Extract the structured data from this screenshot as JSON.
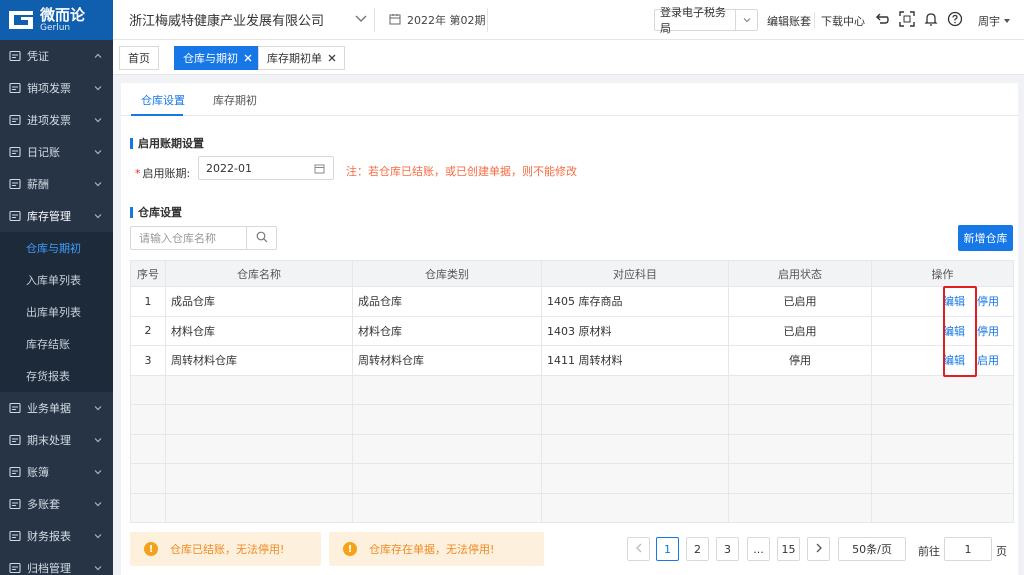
{
  "brand": {
    "name_cn": "微而论",
    "name_en": "Gerlun",
    "color": "#0f5fae"
  },
  "header": {
    "company": "浙江梅威特健康产业发展有限公司",
    "period": "2022年 第02期",
    "tax_bureau": "登录电子税务局",
    "edit_books": "编辑账套",
    "download_center": "下载中心",
    "user": "周宇"
  },
  "sidebar": {
    "items": [
      {
        "label": "凭证",
        "icon": "voucher-icon"
      },
      {
        "label": "销项发票",
        "icon": "invoice-out-icon"
      },
      {
        "label": "进项发票",
        "icon": "invoice-in-icon"
      },
      {
        "label": "日记账",
        "icon": "journal-icon"
      },
      {
        "label": "薪酬",
        "icon": "salary-icon"
      },
      {
        "label": "库存管理",
        "icon": "inventory-icon"
      }
    ],
    "subitems": [
      "仓库与期初",
      "入库单列表",
      "出库单列表",
      "库存结账",
      "存货报表"
    ],
    "items_after": [
      {
        "label": "业务单据",
        "icon": "business-doc-icon"
      },
      {
        "label": "期末处理",
        "icon": "period-end-icon"
      },
      {
        "label": "账簿",
        "icon": "ledger-icon"
      },
      {
        "label": "多账套",
        "icon": "multi-book-icon"
      },
      {
        "label": "财务报表",
        "icon": "report-icon"
      },
      {
        "label": "归档管理",
        "icon": "archive-icon"
      }
    ]
  },
  "tabs": {
    "home": "首页",
    "warehouse": "仓库与期初",
    "inventory_init": "库存期初单"
  },
  "subtabs": {
    "settings": "仓库设置",
    "init": "库存期初"
  },
  "period_section": {
    "title": "启用账期设置",
    "required_mark": "*",
    "label": "启用账期:",
    "value": "2022-01",
    "note": "注：若仓库已结账，或已创建单据，则不能修改"
  },
  "warehouse_section": {
    "title": "仓库设置",
    "search_placeholder": "请输入仓库名称",
    "add_button": "新增仓库"
  },
  "table": {
    "headers": [
      "序号",
      "仓库名称",
      "仓库类别",
      "对应科目",
      "启用状态",
      "操作"
    ],
    "rows": [
      {
        "no": "1",
        "name": "成品仓库",
        "type": "成品仓库",
        "account": "1405 库存商品",
        "status": "已启用",
        "edit": "编辑",
        "toggle": "停用"
      },
      {
        "no": "2",
        "name": "材料仓库",
        "type": "材料仓库",
        "account": "1403 原材料",
        "status": "已启用",
        "edit": "编辑",
        "toggle": "停用"
      },
      {
        "no": "3",
        "name": "周转材料仓库",
        "type": "周转材料仓库",
        "account": "1411 周转材料",
        "status": "停用",
        "edit": "编辑",
        "toggle": "启用"
      }
    ]
  },
  "warnings": {
    "closed": "仓库已结账，无法停用!",
    "has_docs": "仓库存在单据，无法停用!"
  },
  "pagination": {
    "pages": [
      "1",
      "2",
      "3",
      "...",
      "15"
    ],
    "page_size": "50条/页",
    "goto_label": "前往",
    "goto_value": "1",
    "page_unit": "页"
  }
}
